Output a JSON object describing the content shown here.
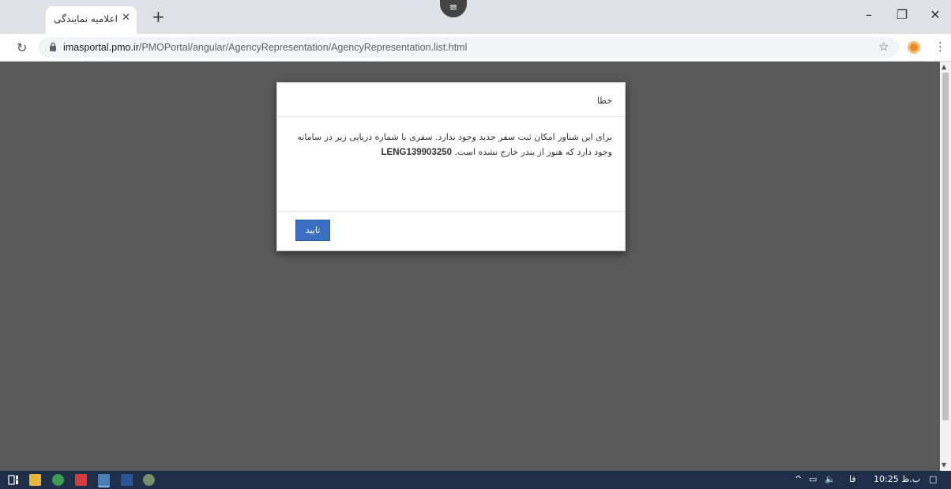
{
  "browser": {
    "tab_title": "اعلامیه نمایندگی",
    "tab_close": "✕",
    "new_tab": "+",
    "menu_pill": "≡",
    "window_minimize": "–",
    "window_restore": "❐",
    "window_close": "✕",
    "url_host": "imasportal.pmo.ir",
    "url_path": "/PMOPortal/angular/AgencyRepresentation/AgencyRepresentation.list.html"
  },
  "dialog": {
    "title": "خطا",
    "message_line1": "برای این شناور امکان ثبت سفر جدید وجود ندارد. سفری با شماره دریایی زیر در سامانه",
    "message_line2": "وجود دارد که هنوز از بندر خارج نشده است.",
    "voyage_code": "LENG139903250",
    "confirm_label": "تایید"
  },
  "taskbar": {
    "clock": "10:25 ب.ظ",
    "lang": "فا",
    "tray_expand": "^"
  },
  "colors": {
    "overlay": "#5a5a5a",
    "button": "#3b6fc4",
    "taskbar": "#1f2f4a"
  }
}
